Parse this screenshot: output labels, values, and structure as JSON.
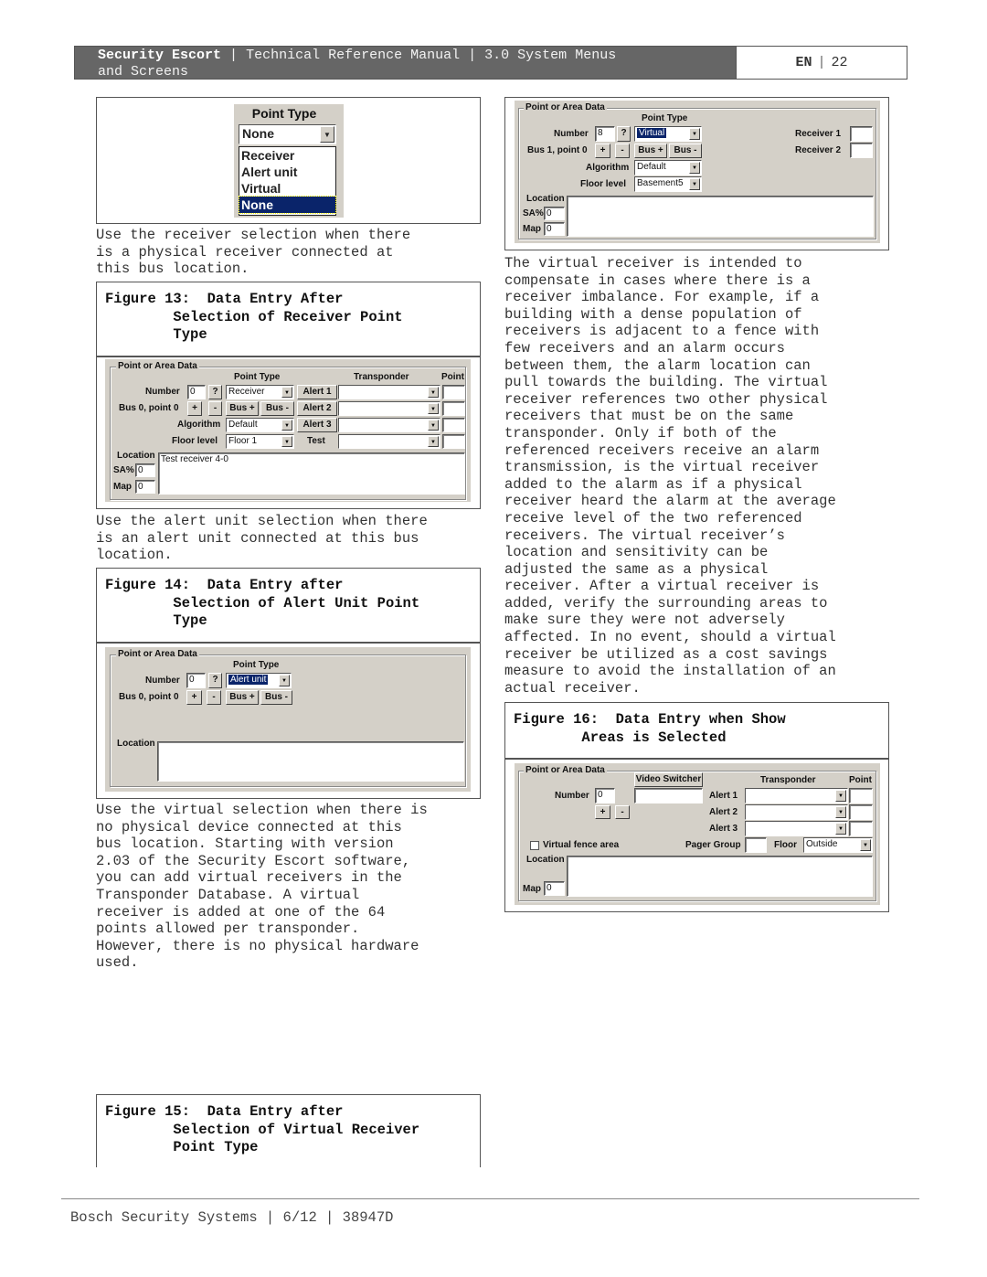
{
  "header": {
    "product": "Security Escort",
    "separator": "|",
    "manual": "Technical Reference Manual",
    "section_line1": "3.0  System Menus",
    "section_line2": "and Screens",
    "language": "EN",
    "page_number": "22"
  },
  "left_column": {
    "point_type_dropdown": {
      "title": "Point Type",
      "selected": "None",
      "options": [
        "Receiver",
        "Alert unit",
        "Virtual",
        "None"
      ],
      "highlighted_option": "None"
    },
    "para_receiver": "Use the receiver selection when there\nis a physical receiver connected at\nthis bus location.",
    "figure13_caption": "Figure 13:  Data Entry After\n        Selection of Receiver Point\n        Type",
    "figure13_dialog": {
      "group_title": "Point or Area Data",
      "point_type_label": "Point Type",
      "transponder_label": "Transponder",
      "point_label": "Point",
      "number_label": "Number",
      "number_value": "0",
      "help_button": "?",
      "point_type_value": "Receiver",
      "bus_label": "Bus 0, point 0",
      "plus_button": "+",
      "minus_button": "-",
      "bus_plus_button": "Bus +",
      "bus_minus_button": "Bus -",
      "algorithm_label": "Algorithm",
      "algorithm_value": "Default",
      "floor_label": "Floor level",
      "floor_value": "Floor 1",
      "alert1_button": "Alert 1",
      "alert2_button": "Alert 2",
      "alert3_button": "Alert 3",
      "test_label": "Test",
      "location_label": "Location",
      "location_value": "Test receiver 4-0",
      "sa_label": "SA%",
      "sa_value": "0",
      "map_label": "Map",
      "map_value": "0"
    },
    "para_alert": "Use the alert unit selection when there\nis an alert unit connected at this bus\nlocation.",
    "figure14_caption": "Figure 14:  Data Entry after\n        Selection of Alert Unit Point\n        Type",
    "figure14_dialog": {
      "group_title": "Point or Area Data",
      "point_type_label": "Point Type",
      "number_label": "Number",
      "number_value": "0",
      "help_button": "?",
      "point_type_value": "Alert unit",
      "bus_label": "Bus 0, point 0",
      "plus_button": "+",
      "minus_button": "-",
      "bus_plus_button": "Bus +",
      "bus_minus_button": "Bus -",
      "location_label": "Location"
    },
    "para_virtual": "Use the virtual selection when there is\nno physical device connected at this\nbus location. Starting with version\n2.03 of the Security Escort software,\nyou can add virtual receivers in the\nTransponder Database. A virtual\nreceiver is added at one of the 64\npoints allowed per transponder.\nHowever, there is no physical hardware\nused.",
    "figure15_caption": "Figure 15:  Data Entry after\n        Selection of Virtual Receiver\n        Point Type"
  },
  "right_column": {
    "figure15_dialog": {
      "group_title": "Point or Area Data",
      "point_type_label": "Point Type",
      "number_label": "Number",
      "number_value": "8",
      "help_button": "?",
      "point_type_value": "Virtual",
      "bus_label": "Bus 1, point 0",
      "plus_button": "+",
      "minus_button": "-",
      "bus_plus_button": "Bus +",
      "bus_minus_button": "Bus -",
      "algorithm_label": "Algorithm",
      "algorithm_value": "Default",
      "floor_label": "Floor level",
      "floor_value": "Basement5",
      "receiver1_label": "Receiver 1",
      "receiver2_label": "Receiver 2",
      "location_label": "Location",
      "sa_label": "SA%",
      "sa_value": "0",
      "map_label": "Map",
      "map_value": "0"
    },
    "para_virtual_receiver": "The virtual receiver is intended to\ncompensate in cases where there is a\nreceiver imbalance. For example, if a\nbuilding with a dense population of\nreceivers is adjacent to a fence with\nfew receivers and an alarm occurs\nbetween them, the alarm location can\npull towards the building. The virtual\nreceiver references two other physical\nreceivers that must be on the same\ntransponder. Only if both of the\nreferenced receivers receive an alarm\ntransmission, is the virtual receiver\nadded to the alarm as if a physical\nreceiver heard the alarm at the average\nreceive level of the two referenced\nreceivers. The virtual receiver’s\nlocation and sensitivity can be\nadjusted the same as a physical\nreceiver. After a virtual receiver is\nadded, verify the surrounding areas to\nmake sure they were not adversely\naffected. In no event, should a virtual\nreceiver be utilized as a cost savings\nmeasure to avoid the installation of an\nactual receiver.",
    "figure16_caption": "Figure 16:  Data Entry when Show\n        Areas is Selected",
    "figure16_dialog": {
      "group_title": "Point or Area Data",
      "video_switcher_button": "Video Switcher",
      "transponder_label": "Transponder",
      "point_label": "Point",
      "number_label": "Number",
      "number_value": "0",
      "plus_button": "+",
      "minus_button": "-",
      "alert1_label": "Alert 1",
      "alert2_label": "Alert 2",
      "alert3_label": "Alert 3",
      "virtual_fence_label": "Virtual fence area",
      "virtual_fence_checked": false,
      "pager_group_label": "Pager Group",
      "floor_label": "Floor",
      "floor_value": "Outside",
      "location_label": "Location",
      "map_label": "Map",
      "map_value": "0"
    }
  },
  "footer": {
    "text": "Bosch Security Systems | 6/12 | 38947D"
  },
  "colors": {
    "header_bg": "#666666",
    "dialog_bg": "#d4d0c8",
    "selection_bg": "#0a246a"
  }
}
